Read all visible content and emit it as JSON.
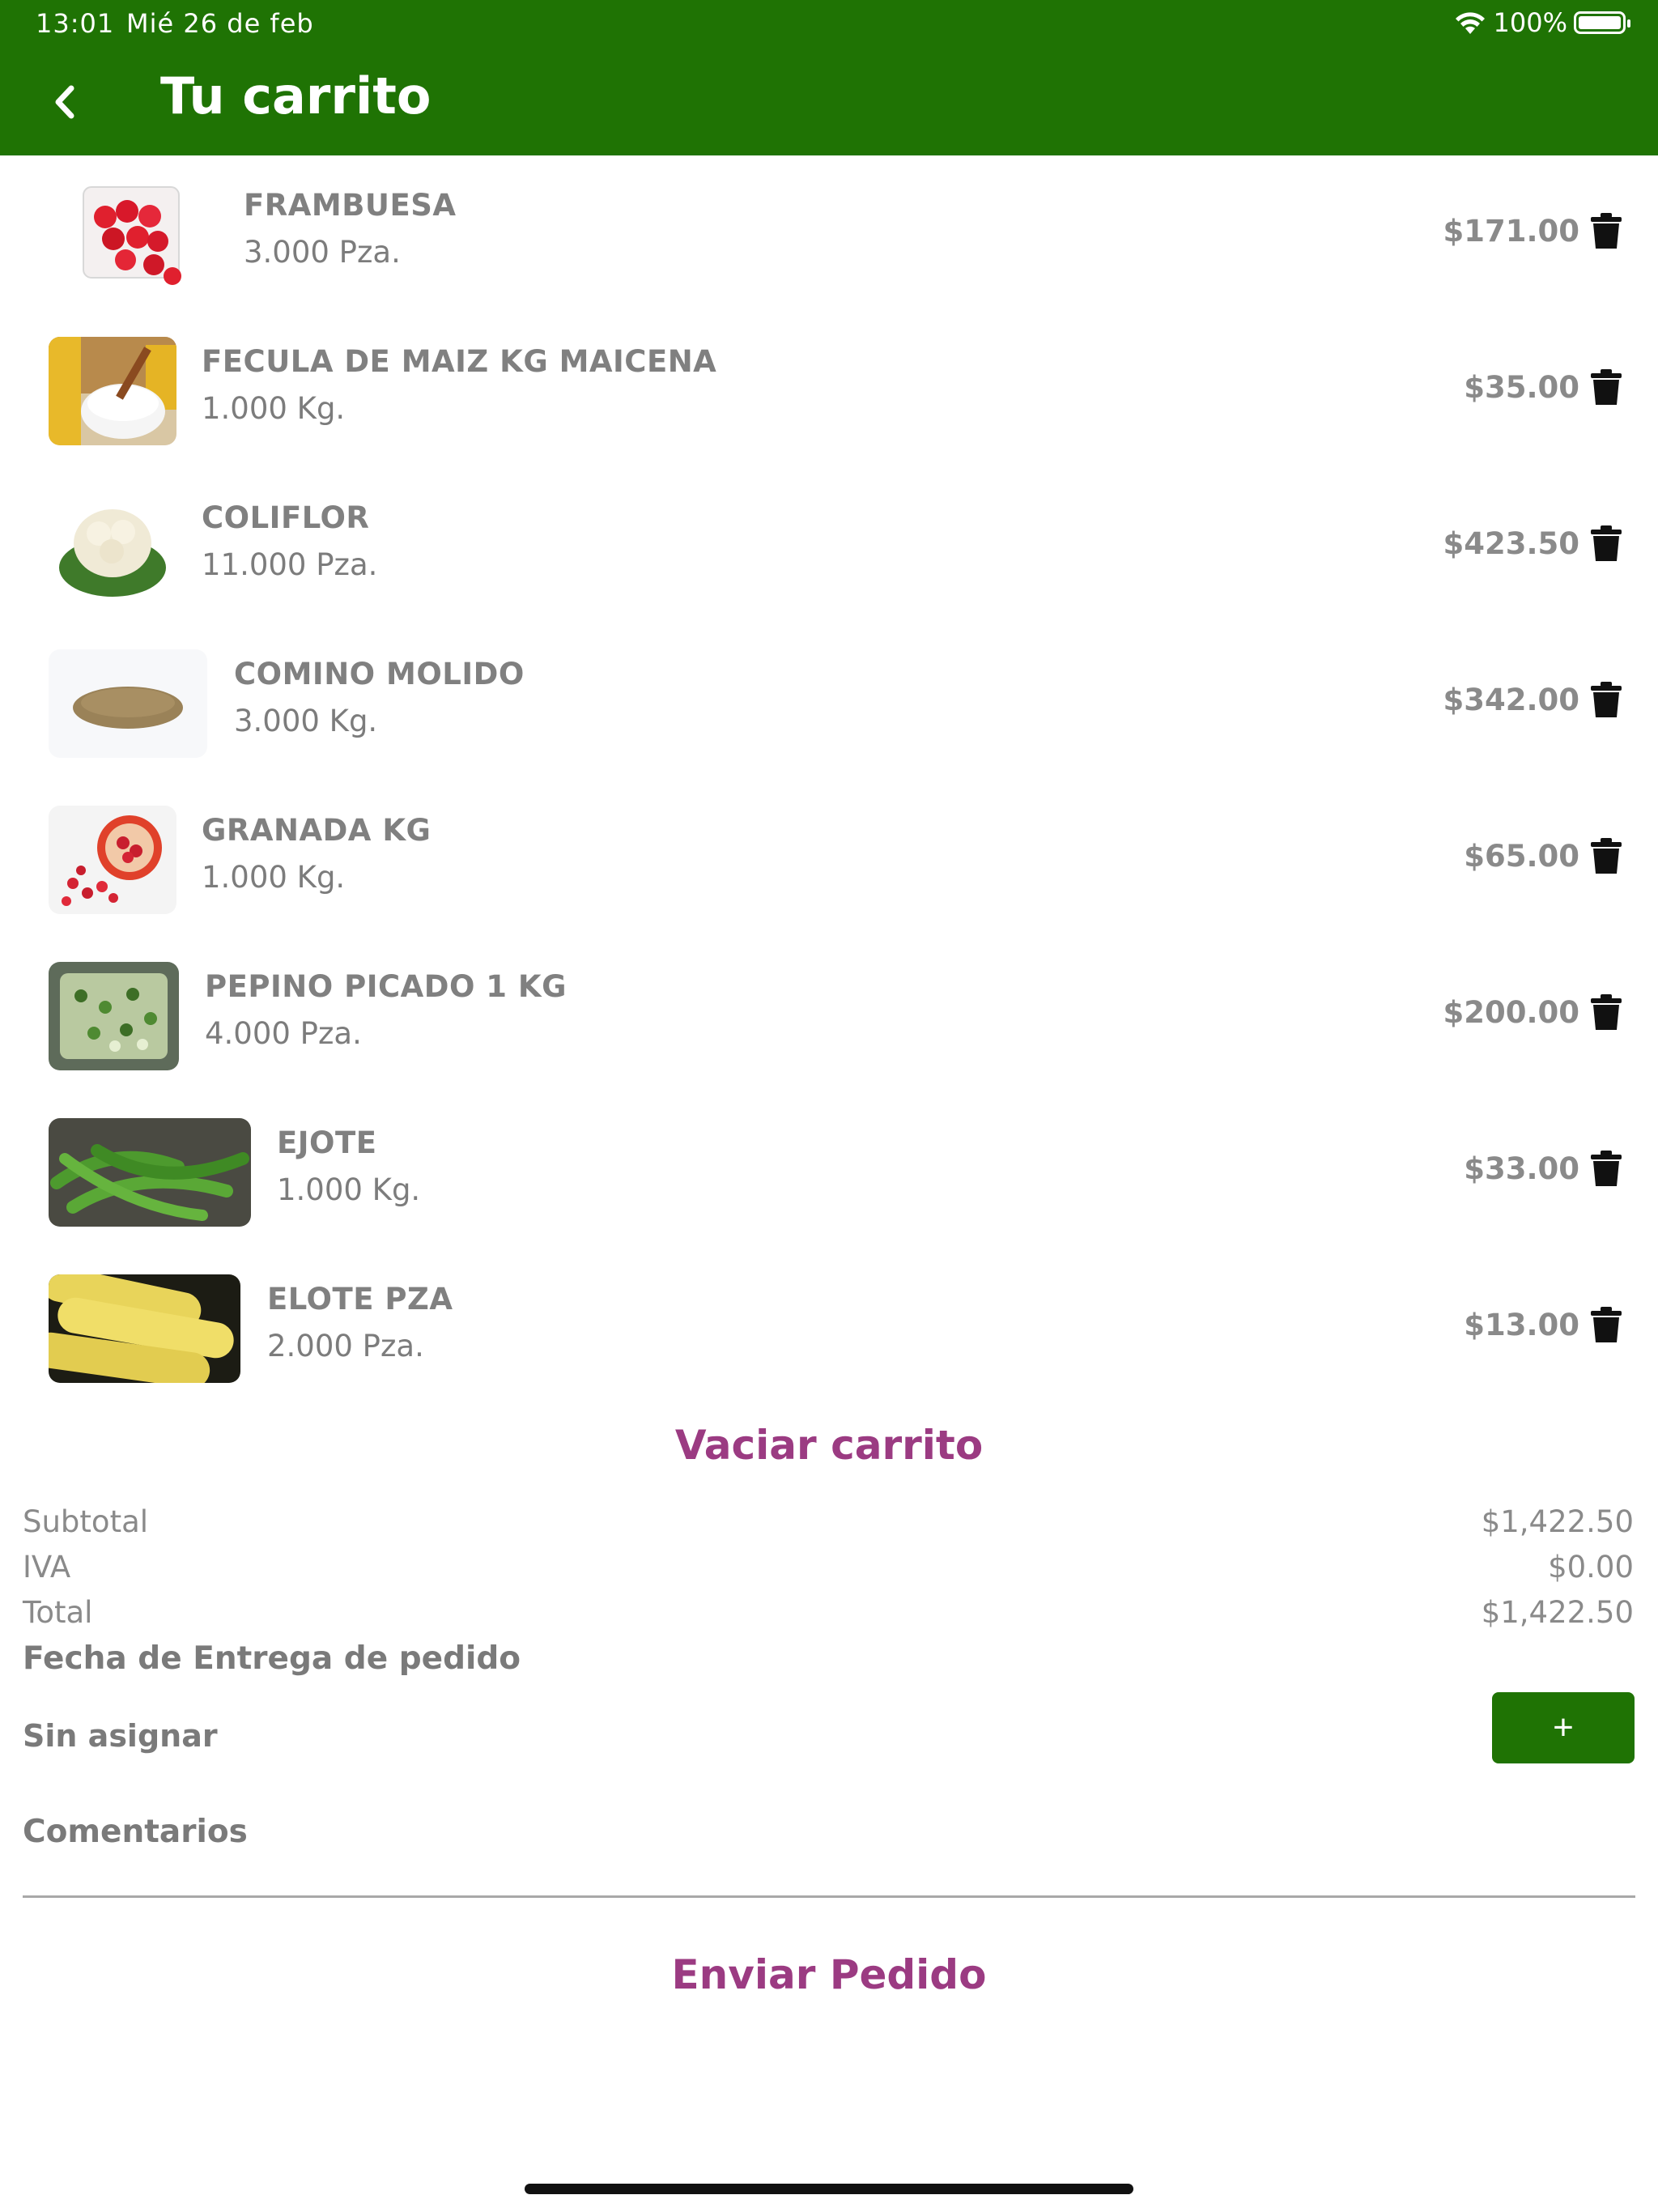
{
  "status_bar": {
    "time": "13:01",
    "date": "Mié 26 de feb",
    "battery": "100%"
  },
  "header": {
    "title": "Tu carrito",
    "back_icon": "chevron-left-icon"
  },
  "items": [
    {
      "name": "FRAMBUESA",
      "qty": "3.000 Pza.",
      "price": "$171.00",
      "image": "raspberries"
    },
    {
      "name": "FECULA DE MAIZ KG MAICENA",
      "qty": "1.000 Kg.",
      "price": "$35.00",
      "image": "corn-starch"
    },
    {
      "name": "COLIFLOR",
      "qty": "11.000 Pza.",
      "price": "$423.50",
      "image": "cauliflower"
    },
    {
      "name": "COMINO MOLIDO",
      "qty": "3.000 Kg.",
      "price": "$342.00",
      "image": "ground-cumin"
    },
    {
      "name": "GRANADA KG",
      "qty": "1.000 Kg.",
      "price": "$65.00",
      "image": "pomegranate"
    },
    {
      "name": "PEPINO PICADO 1 KG",
      "qty": "4.000 Pza.",
      "price": "$200.00",
      "image": "diced-cucumber"
    },
    {
      "name": "EJOTE",
      "qty": "1.000 Kg.",
      "price": "$33.00",
      "image": "green-beans"
    },
    {
      "name": "ELOTE PZA",
      "qty": "2.000 Pza.",
      "price": "$13.00",
      "image": "corn"
    }
  ],
  "empty_cart_label": "Vaciar carrito",
  "summary": {
    "subtotal_label": "Subtotal",
    "subtotal": "$1,422.50",
    "iva_label": "IVA",
    "iva": "$0.00",
    "total_label": "Total",
    "total": "$1,422.50"
  },
  "delivery": {
    "heading": "Fecha de Entrega de pedido",
    "value": "Sin asignar",
    "add_label": "+"
  },
  "comments_label": "Comentarios",
  "send_label": "Enviar Pedido",
  "colors": {
    "header": "#1f7304",
    "accent": "#9b3b82",
    "text_gray": "#808080"
  }
}
